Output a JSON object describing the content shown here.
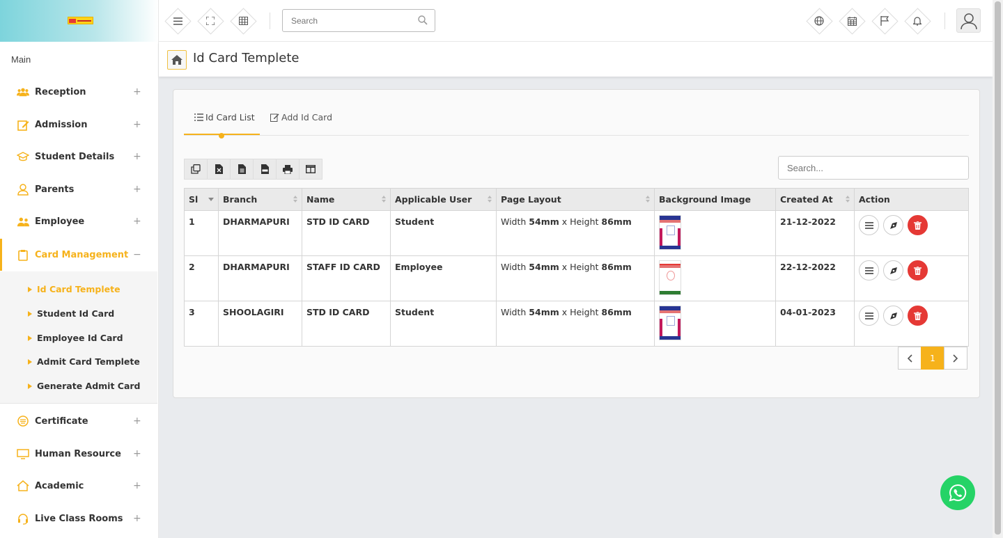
{
  "sidebar": {
    "main_label": "Main",
    "items": [
      {
        "label": "Reception",
        "toggle": "+"
      },
      {
        "label": "Admission",
        "toggle": "+"
      },
      {
        "label": "Student Details",
        "toggle": "+"
      },
      {
        "label": "Parents",
        "toggle": "+"
      },
      {
        "label": "Employee",
        "toggle": "+"
      },
      {
        "label": "Card Management",
        "toggle": "−"
      },
      {
        "label": "Certificate",
        "toggle": "+"
      },
      {
        "label": "Human Resource",
        "toggle": "+"
      },
      {
        "label": "Academic",
        "toggle": "+"
      },
      {
        "label": "Live Class Rooms",
        "toggle": "+"
      }
    ],
    "submenu": [
      {
        "label": "Id Card Templete"
      },
      {
        "label": "Student Id Card"
      },
      {
        "label": "Employee Id Card"
      },
      {
        "label": "Admit Card Templete"
      },
      {
        "label": "Generate Admit Card"
      }
    ]
  },
  "header": {
    "search_placeholder": "Search"
  },
  "page": {
    "title": "Id Card Templete"
  },
  "tabs": [
    {
      "label": "Id Card List"
    },
    {
      "label": "Add Id Card"
    }
  ],
  "table": {
    "search_placeholder": "Search...",
    "columns": [
      "Sl",
      "Branch",
      "Name",
      "Applicable User",
      "Page Layout",
      "Background Image",
      "Created At",
      "Action"
    ],
    "rows": [
      {
        "sl": "1",
        "branch": "DHARMAPURI",
        "name": "STD ID CARD",
        "user": "Student",
        "w_pre": "Width ",
        "w": "54mm",
        "mid": " x Height ",
        "h": "86mm",
        "created": "21-12-2022"
      },
      {
        "sl": "2",
        "branch": "DHARMAPURI",
        "name": "STAFF ID CARD",
        "user": "Employee",
        "w_pre": "Width ",
        "w": "54mm",
        "mid": " x Height ",
        "h": "86mm",
        "created": "22-12-2022"
      },
      {
        "sl": "3",
        "branch": "SHOOLAGIRI",
        "name": "STD ID CARD",
        "user": "Student",
        "w_pre": "Width ",
        "w": "54mm",
        "mid": " x Height ",
        "h": "86mm",
        "created": "04-01-2023"
      }
    ]
  },
  "pagination": {
    "current": "1"
  },
  "colors": {
    "accent": "#f6b21b",
    "danger": "#e53935",
    "whatsapp": "#25d366"
  }
}
